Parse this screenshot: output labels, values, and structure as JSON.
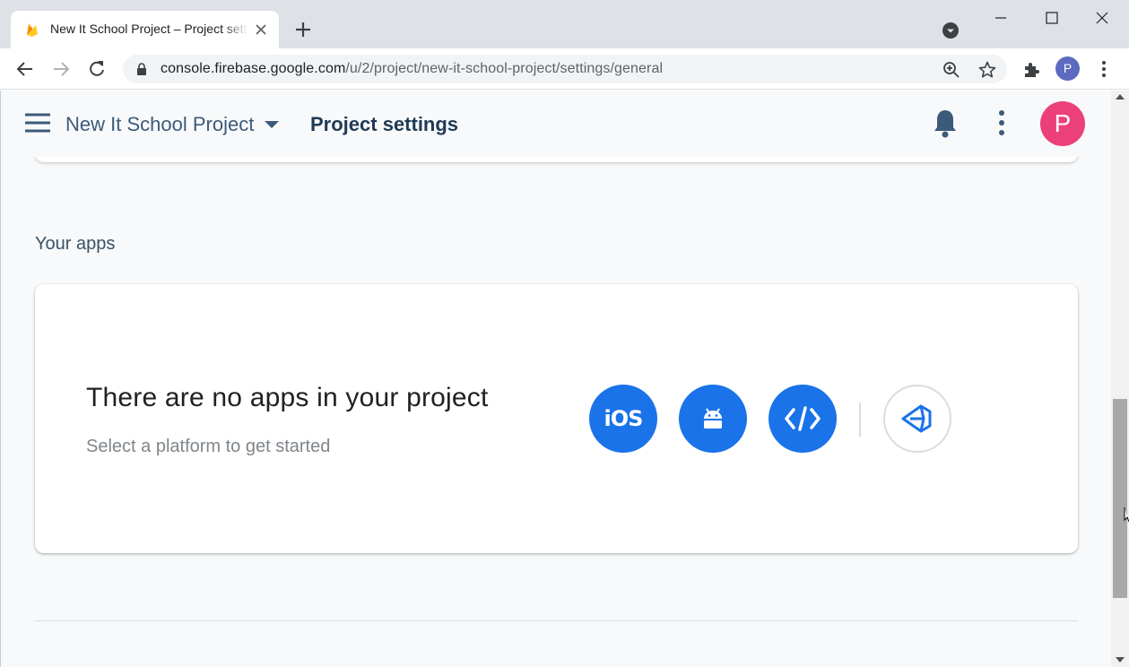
{
  "browser": {
    "tab": {
      "title": "New It School Project – Project settings",
      "close_icon": "close-icon"
    },
    "new_tab_icon": "plus-icon",
    "window_controls": [
      "minimize",
      "maximize",
      "close"
    ],
    "address_bar": {
      "host": "console.firebase.google.com",
      "path": "/u/2/project/new-it-school-project/settings/general"
    },
    "profile_initial": "P"
  },
  "header": {
    "project_name": "New It School Project",
    "page_title": "Project settings",
    "avatar_initial": "P",
    "colors": {
      "avatar": "#ec407a",
      "text": "#3c5a7a"
    }
  },
  "apps_section": {
    "title": "Your apps",
    "empty_title": "There are no apps in your project",
    "empty_subtitle": "Select a platform to get started",
    "platforms": [
      {
        "id": "ios",
        "label": "iOS"
      },
      {
        "id": "android",
        "icon": "android-icon"
      },
      {
        "id": "web",
        "icon": "code-icon"
      },
      {
        "id": "unity",
        "icon": "unity-icon"
      }
    ],
    "accent": "#1a73e8"
  }
}
